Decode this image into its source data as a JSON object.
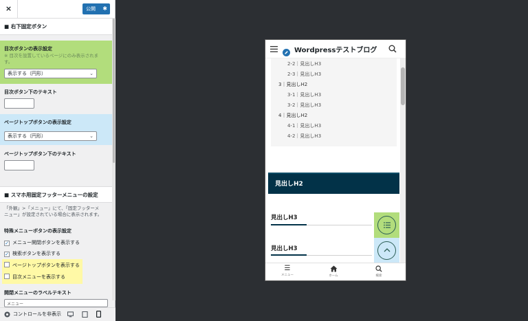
{
  "topbar": {
    "close_icon": "×",
    "publish_label": "公開"
  },
  "section1": {
    "heading": "■ 右下固定ボタン",
    "toc_setting": {
      "label": "目次ボタンの表示設定",
      "desc_line1": "※ 目次を設置しているページにのみ表示されま",
      "desc_line2": "す。",
      "value": "表示する（円形）"
    },
    "toc_text_label": "目次ボタン下のテキスト",
    "pagetop_setting": {
      "label": "ページトップボタンの表示設定",
      "value": "表示する（円形）"
    },
    "pagetop_text_label": "ページトップボタン下のテキスト"
  },
  "section2": {
    "heading": "■ スマホ用固定フッターメニューの設定",
    "desc_line1": "「外観」>「メニュー」にて、「固定フッターメ",
    "desc_line2": "ニュー」が設定されている場合に表示されます。",
    "special_label": "特殊メニューボタンの表示設定",
    "checks": [
      {
        "label": "メニュー開閉ボタンを表示する",
        "checked": true
      },
      {
        "label": "検索ボタンを表示する",
        "checked": true
      },
      {
        "label": "ページトップボタンを表示する",
        "checked": false
      },
      {
        "label": "目次メニューを表示する",
        "checked": false
      }
    ],
    "open_menu_label": "開閉メニューのラベルテキスト",
    "open_menu_value": "メニュー"
  },
  "footer": {
    "hide_controls_label": "コントロールを非表示"
  },
  "preview": {
    "site_title": "Wordpressテストブログ",
    "toc_items": [
      "2-2｜見出しH3",
      "2-3｜見出しH3",
      "3｜見出しH2",
      "3-1｜見出しH3",
      "3-2｜見出しH3",
      "4｜見出しH2",
      "4-1｜見出しH3",
      "4-2｜見出しH3"
    ],
    "h2_text": "見出しH2",
    "h3_texts": [
      "見出しH3",
      "見出しH3"
    ],
    "nav": [
      {
        "label": "メニュー",
        "icon": "menu-icon"
      },
      {
        "label": "ホーム",
        "icon": "home-icon"
      },
      {
        "label": "検索",
        "icon": "search-icon"
      }
    ]
  },
  "colors": {
    "green": "#b2dd7c",
    "blue": "#cce8f8",
    "yellow": "#fff9a6",
    "accent": "#023248",
    "publish": "#2271b1"
  }
}
